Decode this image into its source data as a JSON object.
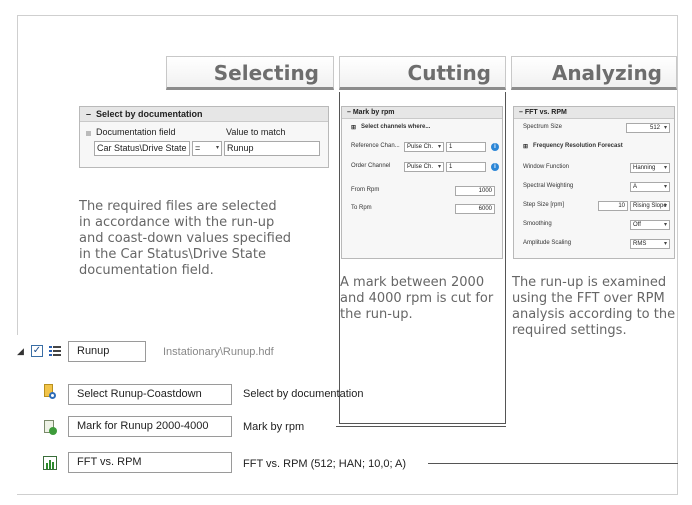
{
  "headers": {
    "selecting": "Selecting",
    "cutting": "Cutting",
    "analyzing": "Analyzing"
  },
  "select_panel": {
    "title": "Select by documentation",
    "doc_field_label": "Documentation field",
    "value_label": "Value to match",
    "doc_field_value": "Car Status\\Drive State",
    "operator": "=",
    "match_value": "Runup"
  },
  "cut_panel": {
    "title": "Mark by rpm",
    "select_channels": "Select channels where...",
    "ref_channel_label": "Reference Chan...",
    "ref_channel_value": "Pulse Ch.",
    "ref_channel_num": "1",
    "order_channel_label": "Order Channel",
    "order_channel_value": "Pulse Ch.",
    "order_channel_num": "1",
    "from_rpm_label": "From Rpm",
    "from_rpm_value": "1000",
    "to_rpm_label": "To Rpm",
    "to_rpm_value": "6000"
  },
  "fft_panel": {
    "title": "FFT vs. RPM",
    "spectrum_size_label": "Spectrum Size",
    "spectrum_size_value": "512",
    "freq_res": "Frequency Resolution Forecast",
    "window_label": "Window Function",
    "window_value": "Hanning",
    "weighting_label": "Spectral Weighting",
    "weighting_value": "A",
    "step_label": "Step Size [rpm]",
    "step_value": "10",
    "step_mode": "Rising Slope",
    "smoothing_label": "Smoothing",
    "smoothing_value": "Off",
    "amplitude_label": "Amplitude Scaling",
    "amplitude_value": "RMS"
  },
  "descriptions": {
    "selecting": [
      "The required files are selected",
      "in accordance with the run-up",
      "and coast-down values specified",
      "in the Car Status\\Drive State",
      "documentation field."
    ],
    "cutting": [
      "A mark between 2000",
      "and 4000 rpm is cut for",
      "the run-up."
    ],
    "analyzing": [
      "The run-up is examined",
      "using the FFT over RPM",
      "analysis according to the",
      "required settings."
    ]
  },
  "tree": {
    "root_name": "Runup",
    "root_path": "Instationary\\Runup.hdf",
    "steps": [
      {
        "name": "Select Runup-Coastdown",
        "type": "Select by documentation",
        "icon": "select-icon"
      },
      {
        "name": "Mark for Runup 2000-4000",
        "type": "Mark by rpm",
        "icon": "mark-icon"
      },
      {
        "name": "FFT vs. RPM",
        "type": "FFT vs. RPM (512; HAN; 10,0; A)",
        "icon": "chart-icon"
      }
    ]
  }
}
